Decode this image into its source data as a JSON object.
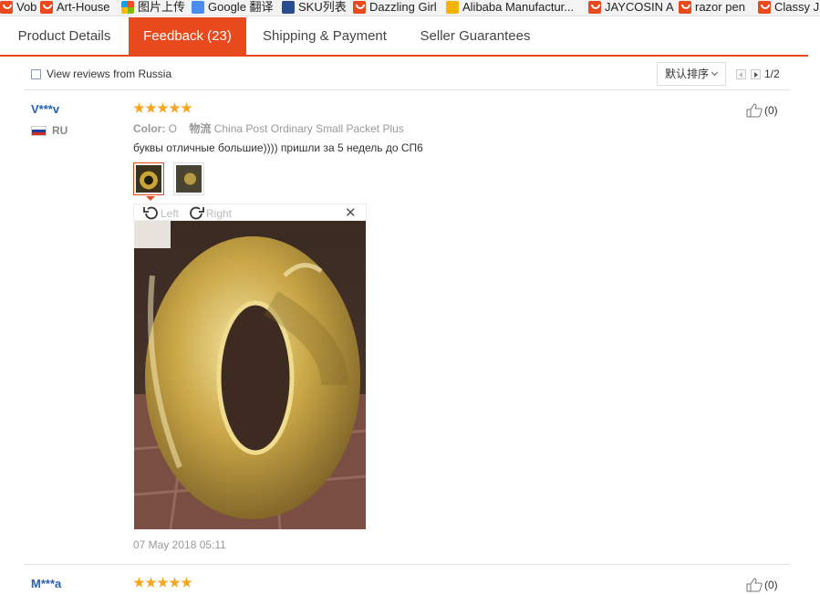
{
  "bookmarks": [
    {
      "label": "Vob",
      "icon": "red-shield-icon"
    },
    {
      "label": "Art-House",
      "icon": "red-shield-icon"
    },
    {
      "label": "图片上传",
      "icon": "windows-icon"
    },
    {
      "label": "Google 翻译",
      "icon": "translate-icon"
    },
    {
      "label": "SKU列表",
      "icon": "sku-icon"
    },
    {
      "label": "Dazzling Girl",
      "icon": "red-shield-icon"
    },
    {
      "label": "Alibaba Manufactur...",
      "icon": "alibaba-icon"
    },
    {
      "label": "JAYCOSIN A",
      "icon": "red-shield-icon"
    },
    {
      "label": "razor pen",
      "icon": "red-shield-icon"
    },
    {
      "label": "Classy J",
      "icon": "red-shield-icon"
    }
  ],
  "tabs": [
    {
      "label": "Product Details",
      "active": false
    },
    {
      "label": "Feedback (23)",
      "active": true
    },
    {
      "label": "Shipping & Payment",
      "active": false
    },
    {
      "label": "Seller Guarantees",
      "active": false
    }
  ],
  "filter": {
    "russia_label": "View reviews from Russia",
    "sort_value": "默认排序",
    "page_count": "1/2"
  },
  "reviews": [
    {
      "name": "V***v",
      "country": "RU",
      "stars": 5,
      "likes": "(0)",
      "color_label": "Color:",
      "color_value": "O",
      "logistics_label": "物流",
      "logistics_value": "China Post Ordinary Small Packet Plus",
      "text": "буквы отличные большие)))) пришли за 5 недель до СП6",
      "rotate_left": "Left",
      "rotate_right": "Right",
      "date": "07 May 2018 05:11"
    },
    {
      "name": "M***a",
      "stars": 5,
      "likes": "(0)"
    }
  ],
  "colors": {
    "accent": "#e8491d",
    "link": "#2760b0",
    "star": "#f5a623"
  }
}
